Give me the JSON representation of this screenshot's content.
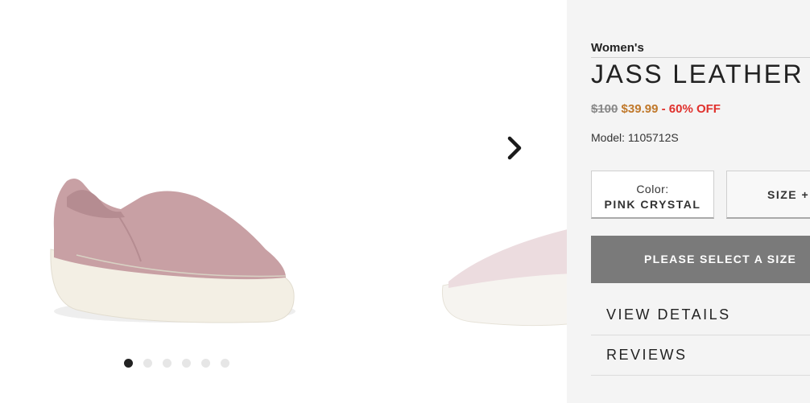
{
  "gallery": {
    "image_count": 6,
    "active_index": 0,
    "next_icon": "chevron-right-icon",
    "product_colors": {
      "upper": "#c8a0a4",
      "sole": "#f3efe4",
      "peek_upper": "#ecdcdf"
    }
  },
  "product": {
    "gender": "Women's",
    "title": "JASS LEATHER",
    "price_original": "$100",
    "price_sale": "$39.99",
    "price_discount": "- 60% OFF",
    "model": "Model: 1105712S"
  },
  "options": {
    "color_label": "Color:",
    "color_value": "PINK CRYSTAL",
    "size_label": "SIZE +"
  },
  "cta": {
    "label": "PLEASE SELECT A SIZE",
    "bg_color": "#7a7a7a"
  },
  "accordion": [
    {
      "label": "VIEW DETAILS"
    },
    {
      "label": "REVIEWS"
    }
  ],
  "colors": {
    "sale_price": "#c0782a",
    "discount": "#e0302c",
    "panel_bg": "#f4f4f4"
  }
}
